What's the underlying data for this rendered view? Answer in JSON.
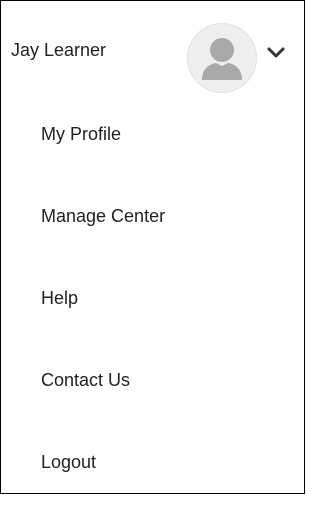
{
  "user": {
    "name": "Jay Learner",
    "avatar_icon": "user-silhouette-icon",
    "dropdown_icon": "chevron-down-icon"
  },
  "menu": {
    "items": [
      {
        "label": "My Profile"
      },
      {
        "label": "Manage Center"
      },
      {
        "label": "Help"
      },
      {
        "label": "Contact Us"
      },
      {
        "label": "Logout"
      }
    ]
  },
  "colors": {
    "text": "#222222",
    "avatar_bg": "#eeeeee",
    "avatar_figure": "#a9a9a9",
    "border": "#000000"
  }
}
